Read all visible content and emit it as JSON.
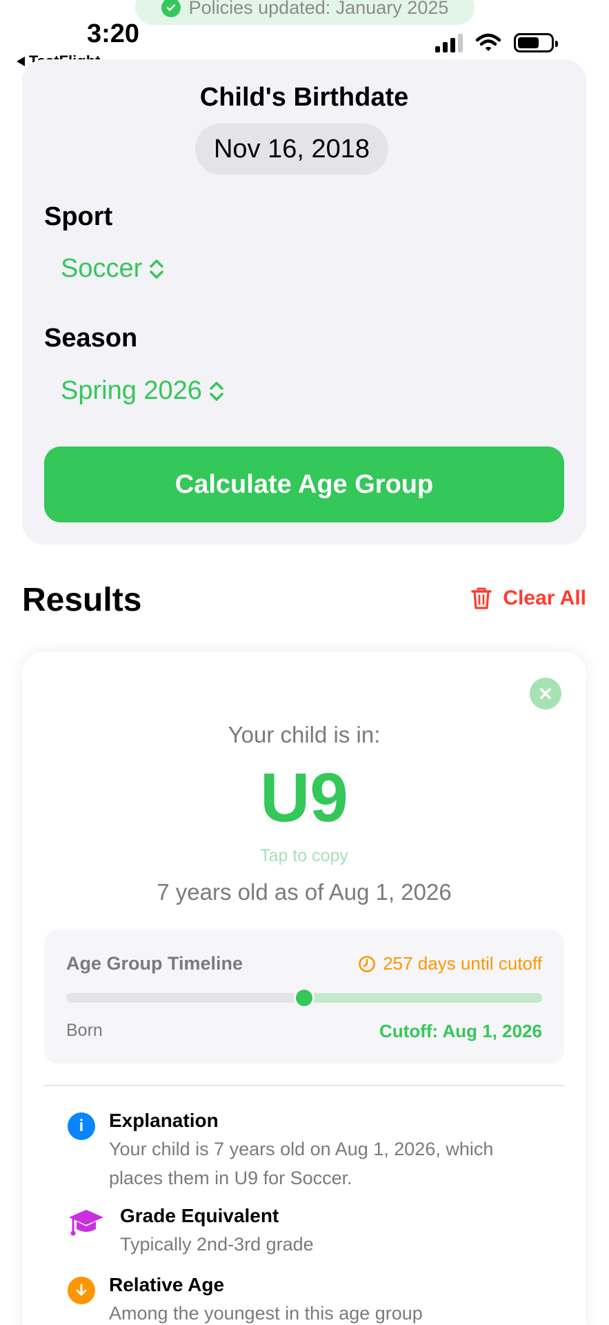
{
  "status_bar": {
    "banner": "Policies updated: January 2025",
    "time": "3:20",
    "back_app": "TestFlight"
  },
  "form": {
    "birthdate_label": "Child's Birthdate",
    "birthdate_value": "Nov 16, 2018",
    "sport_label": "Sport",
    "sport_value": "Soccer",
    "season_label": "Season",
    "season_value": "Spring 2026",
    "calculate_label": "Calculate Age Group"
  },
  "results": {
    "title": "Results",
    "clear_label": "Clear All",
    "intro": "Your child is in:",
    "group": "U9",
    "tap_hint": "Tap to copy",
    "age_line": "7 years old as of Aug 1, 2026",
    "timeline": {
      "title": "Age Group Timeline",
      "days": "257 days until cutoff",
      "progress": 0.5,
      "start_label": "Born",
      "end_label": "Cutoff: Aug 1, 2026"
    },
    "info": [
      {
        "title": "Explanation",
        "text": "Your child is 7 years old on Aug 1, 2026, which places them in U9 for Soccer.",
        "icon": "info-icon",
        "color": "#0a84ff"
      },
      {
        "title": "Grade Equivalent",
        "text": "Typically 2nd-3rd grade",
        "icon": "graduation-cap-icon",
        "color": "#c930e0"
      },
      {
        "title": "Relative Age",
        "text": "Among the youngest in this age group",
        "icon": "arrow-down-circle-icon",
        "color": "#ff9500"
      }
    ]
  },
  "colors": {
    "accent": "#34c759",
    "danger": "#ff3b30",
    "warning": "#ff9500"
  }
}
